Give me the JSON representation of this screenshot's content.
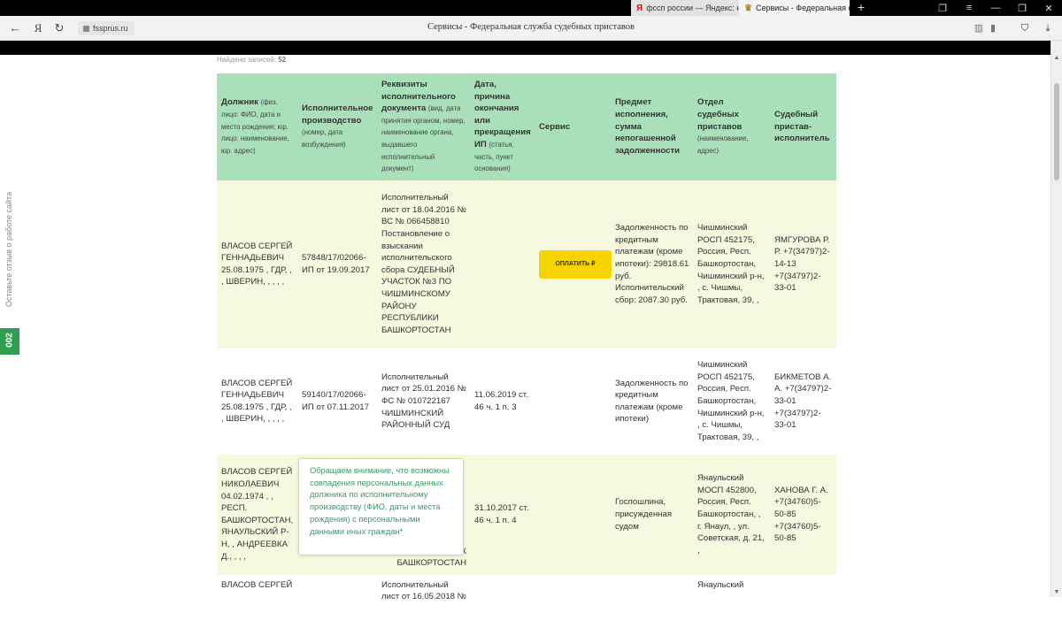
{
  "browser": {
    "tabs": [
      {
        "favicon": "Я",
        "title": "фссп россии — Яндекс: наш"
      },
      {
        "favicon": "♛",
        "title": "Сервисы - Федеральная с"
      }
    ],
    "new_tab": "+",
    "url": "fssprus.ru",
    "page_title": "Сервисы - Федеральная служба судебных приставов",
    "nav": {
      "back": "←",
      "yandex": "Я",
      "reload": "↻"
    }
  },
  "sidebar": {
    "feedback_text": "Оставьте отзыв о работе сайта",
    "badge": "002"
  },
  "results": {
    "found_label": "Найдено записей:",
    "found_count": "52"
  },
  "table": {
    "headers": [
      {
        "title": "Должник",
        "note": "(физ. лицо: ФИО, дата и место рождения; юр. лицо: наименование, юр. адрес)"
      },
      {
        "title": "Исполнительное производство",
        "note": "(номер, дата возбуждения)"
      },
      {
        "title": "Реквизиты исполнительного документа",
        "note": "(вид, дата принятия органом, номер, наименование органа, выдавшего исполнительный документ)"
      },
      {
        "title": "Дата, причина окончания или прекращения ИП",
        "note": "(статья, часть, пункт основания)"
      },
      {
        "title": "Сервис",
        "note": ""
      },
      {
        "title": "Предмет исполнения, сумма непогашенной задолженности",
        "note": ""
      },
      {
        "title": "Отдел судебных приставов",
        "note": "(наименование, адрес)"
      },
      {
        "title": "Судебный пристав-исполнитель",
        "note": ""
      }
    ],
    "rows": [
      {
        "debtor": "ВЛАСОВ СЕРГЕЙ ГЕННАДЬЕВИЧ 25.08.1975 , ГДР, , , ШВЕРИН, , , , ,",
        "proceeding": "57848/17/02066-ИП от 19.09.2017",
        "document": "Исполнительный лист от 18.04.2016 № ВС № 066458810 Постановление о взыскании исполнительского сбора СУДЕБНЫЙ УЧАСТОК №3 ПО ЧИШМИНСКОМУ РАЙОНУ РЕСПУБЛИКИ БАШКОРТОСТАН",
        "end": "",
        "service": "ОПЛАТИТЬ ₽",
        "subject": "Задолженность по кредитным платежам (кроме ипотеки): 29818.61 руб. Исполнительский сбор: 2087.30 руб.",
        "department": "Чишминский РОСП 452175, Россия, Респ. Башкортостан, Чишминский р-н, , с. Чишмы, Трактовая, 39, ,",
        "bailiff": "ЯМГУРОВА Р. Р. +7(34797)2-14-13 +7(34797)2-33-01"
      },
      {
        "debtor": "ВЛАСОВ СЕРГЕЙ ГЕННАДЬЕВИЧ 25.08.1975 , ГДР, , , ШВЕРИН, , , , ,",
        "proceeding": "59140/17/02066-ИП от 07.11.2017",
        "document": "Исполнительный лист от 25.01.2016 № ФС № 010722167 ЧИШМИНСКИЙ РАЙОННЫЙ СУД",
        "end": "11.06.2019 ст. 46 ч. 1 п. 3",
        "service": "",
        "subject": "Задолженность по кредитным платежам (кроме ипотеки)",
        "department": "Чишминский РОСП 452175, Россия, Респ. Башкортостан, Чишминский р-н, , с. Чишмы, Трактовая, 39, ,",
        "bailiff": "БИКМЕТОВ А. А. +7(34797)2-33-01 +7(34797)2-33-01"
      },
      {
        "debtor": "ВЛАСОВ СЕРГЕЙ НИКОЛАЕВИЧ 04.02.1974 , , РЕСП. БАШКОРТОСТАН, ЯНАУЛЬСКИЙ Р-Н, , АНДРЕЕВКА Д., , , ,",
        "proceeding": "",
        "document": "№ К БАШКОРТОСТАН",
        "end": "31.10.2017 ст. 46 ч. 1 п. 4",
        "service": "",
        "subject": "Госпошлина, присужденная судом",
        "department": "Янаульский МОСП 452800, Россия, Респ. Башкортостан, , г. Янаул, , ул. Советская, д. 21, ,",
        "bailiff": "ХАНОВА Г. А. +7(34760)5-50-85 +7(34760)5-50-85"
      },
      {
        "debtor": "ВЛАСОВ СЕРГЕЙ",
        "proceeding": "",
        "document": "Исполнительный лист от 16.05.2018 №",
        "end": "",
        "service": "",
        "subject": "",
        "department": "Янаульский",
        "bailiff": ""
      }
    ]
  },
  "tooltip": {
    "text": "Обращаем внимание, что возможны совпадения персональных данных должника по исполнительному производству (ФИО, даты и места рождения) с персональными данными иных граждан*"
  },
  "colors": {
    "header_bg": "#a9e0b9",
    "row_alt_bg": "#f6f8df",
    "pay_button": "#f5d400",
    "tooltip_text": "#3d9a68",
    "feedback_badge": "#2e9e4f"
  }
}
